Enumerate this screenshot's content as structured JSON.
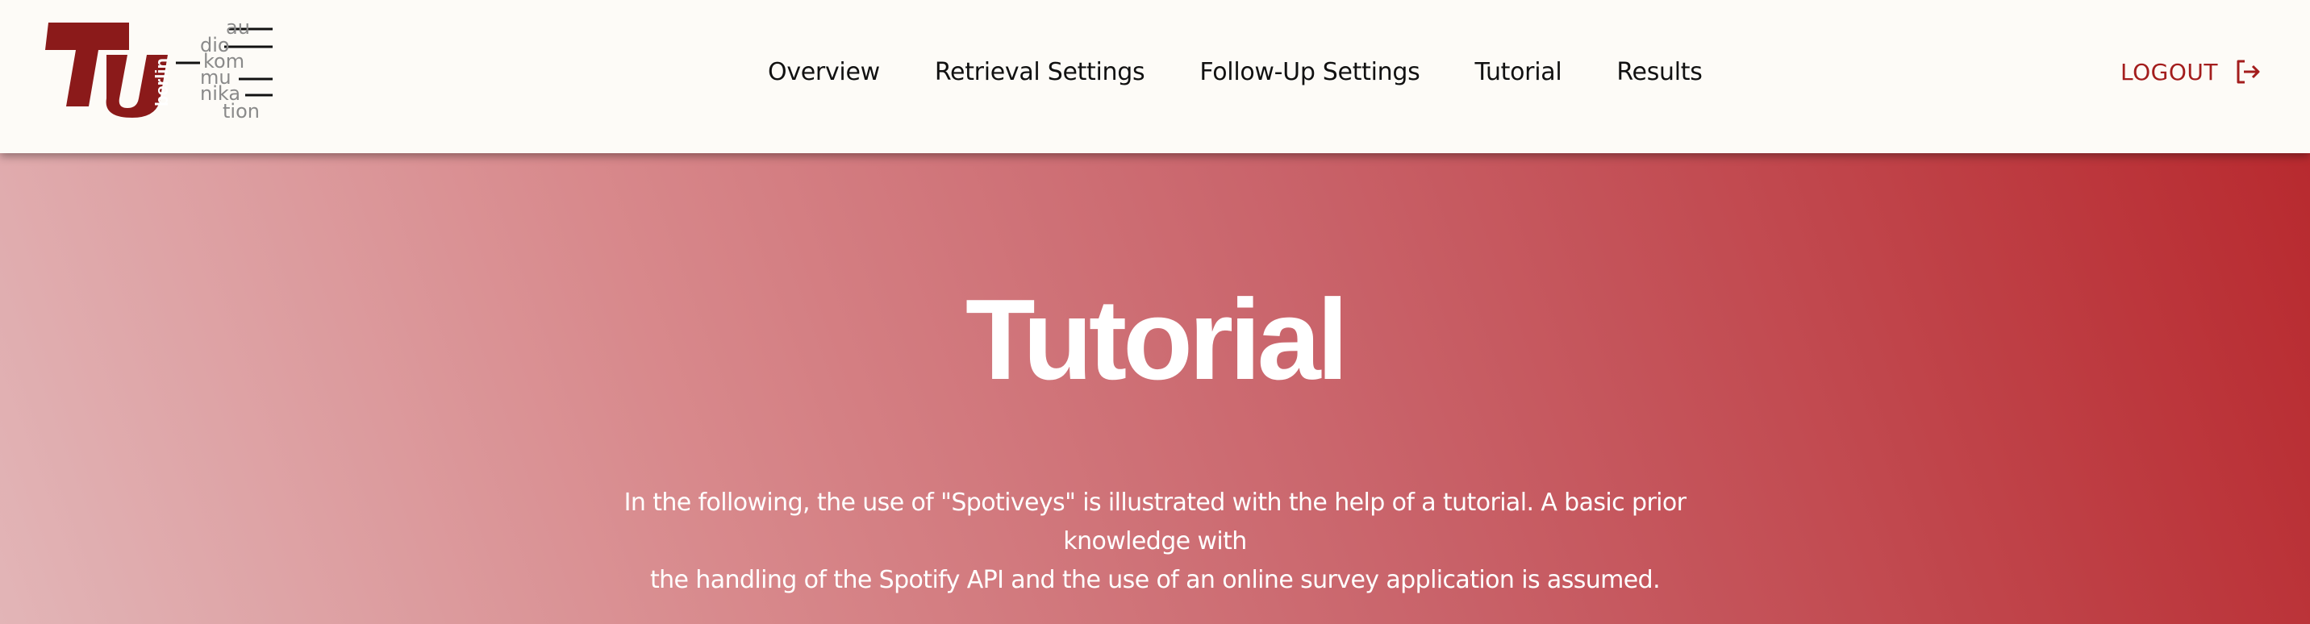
{
  "logo": {
    "brand": "TU",
    "city": "berlin",
    "dept_lines": [
      "au",
      "dio",
      "kom",
      "mu",
      "nika",
      "tion"
    ],
    "primary_color": "#8b1a1a",
    "secondary_color": "#8a8a8a"
  },
  "nav": {
    "items": [
      {
        "label": "Overview"
      },
      {
        "label": "Retrieval Settings"
      },
      {
        "label": "Follow-Up Settings"
      },
      {
        "label": "Tutorial"
      },
      {
        "label": "Results"
      }
    ],
    "logout_label": "LOGOUT",
    "logout_icon": "logout-icon",
    "accent_color": "#a31d1d"
  },
  "hero": {
    "title": "Tutorial",
    "description_line1": "In the following, the use of \"Spotiveys\" is illustrated with the help of a tutorial. A basic prior knowledge with",
    "description_line2": "the handling of the Spotify API and the use of an online survey application is assumed.",
    "gradient_start": "#e2b5b7",
    "gradient_end": "#b82a2f"
  }
}
